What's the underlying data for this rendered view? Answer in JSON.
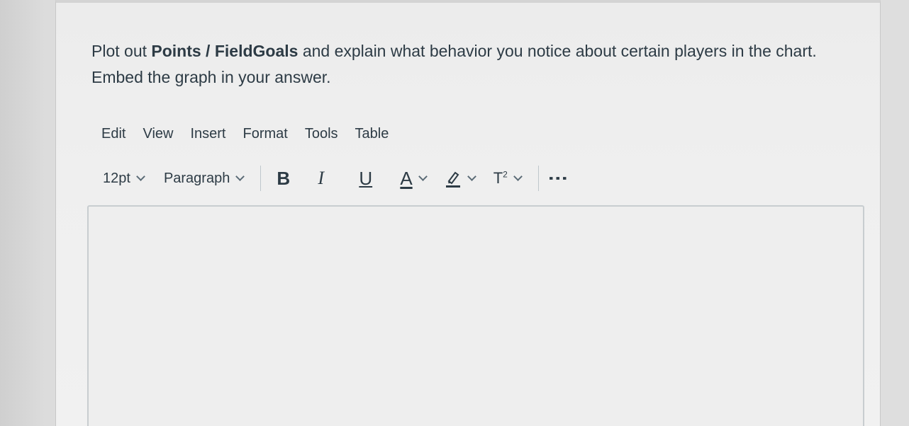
{
  "question": {
    "part1": "Plot out ",
    "bold1": "Points",
    "part2": " / ",
    "bold2": "FieldGoals",
    "part3": " and explain what behavior you notice about certain players in the chart. Embed the graph in your answer."
  },
  "menubar": {
    "items": [
      "Edit",
      "View",
      "Insert",
      "Format",
      "Tools",
      "Table"
    ]
  },
  "toolbar": {
    "font_size": "12pt",
    "block_format": "Paragraph",
    "bold": "B",
    "italic": "I",
    "underline": "U",
    "text_color": "A",
    "superscript": "T",
    "superscript_mark": "2",
    "more": "⋮"
  },
  "editor": {
    "content": ""
  }
}
